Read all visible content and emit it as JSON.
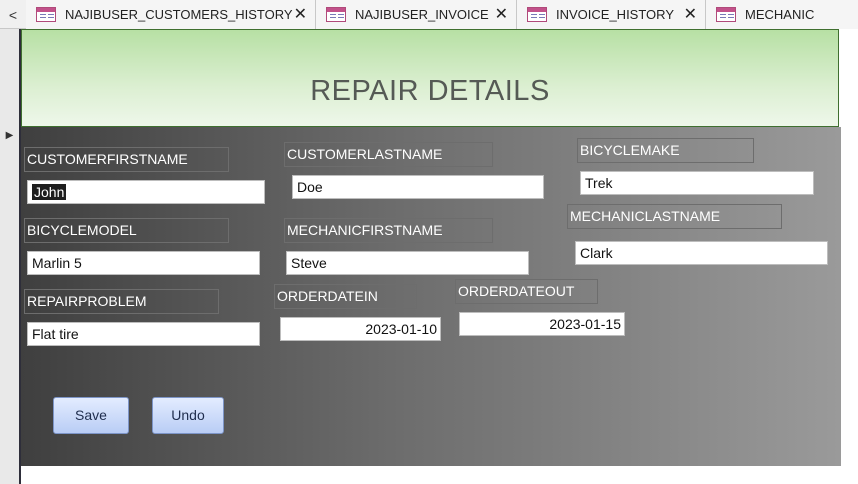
{
  "tabs": [
    {
      "label": "NAJIBUSER_CUSTOMERS_HISTORY"
    },
    {
      "label": "NAJIBUSER_INVOICE"
    },
    {
      "label": "INVOICE_HISTORY"
    },
    {
      "label": "MECHANIC"
    }
  ],
  "tab_nav_glyph": "<",
  "close_glyph": "✕",
  "record_selector_glyph": "▶",
  "form": {
    "title": "REPAIR DETAILS",
    "labels": {
      "customer_first_name": "CUSTOMERFIRSTNAME",
      "customer_last_name": "CUSTOMERLASTNAME",
      "bicycle_make": "BICYCLEMAKE",
      "bicycle_model": "BICYCLEMODEL",
      "mechanic_first_name": "MECHANICFIRSTNAME",
      "mechanic_last_name": "MECHANICLASTNAME",
      "repair_problem": "REPAIRPROBLEM",
      "order_date_in": "ORDERDATEIN",
      "order_date_out": "ORDERDATEOUT"
    },
    "values": {
      "customer_first_name": "John",
      "customer_last_name": "Doe",
      "bicycle_make": "Trek",
      "bicycle_model": "Marlin 5",
      "mechanic_first_name": "Steve",
      "mechanic_last_name": "Clark",
      "repair_problem": "Flat tire",
      "order_date_in": "2023-01-10",
      "order_date_out": "2023-01-15"
    },
    "buttons": {
      "save": "Save",
      "undo": "Undo"
    }
  },
  "colors": {
    "header_green": "#b7e0a4",
    "button_blue": "#b9cdf5",
    "tab_icon_pink": "#c2518a"
  }
}
